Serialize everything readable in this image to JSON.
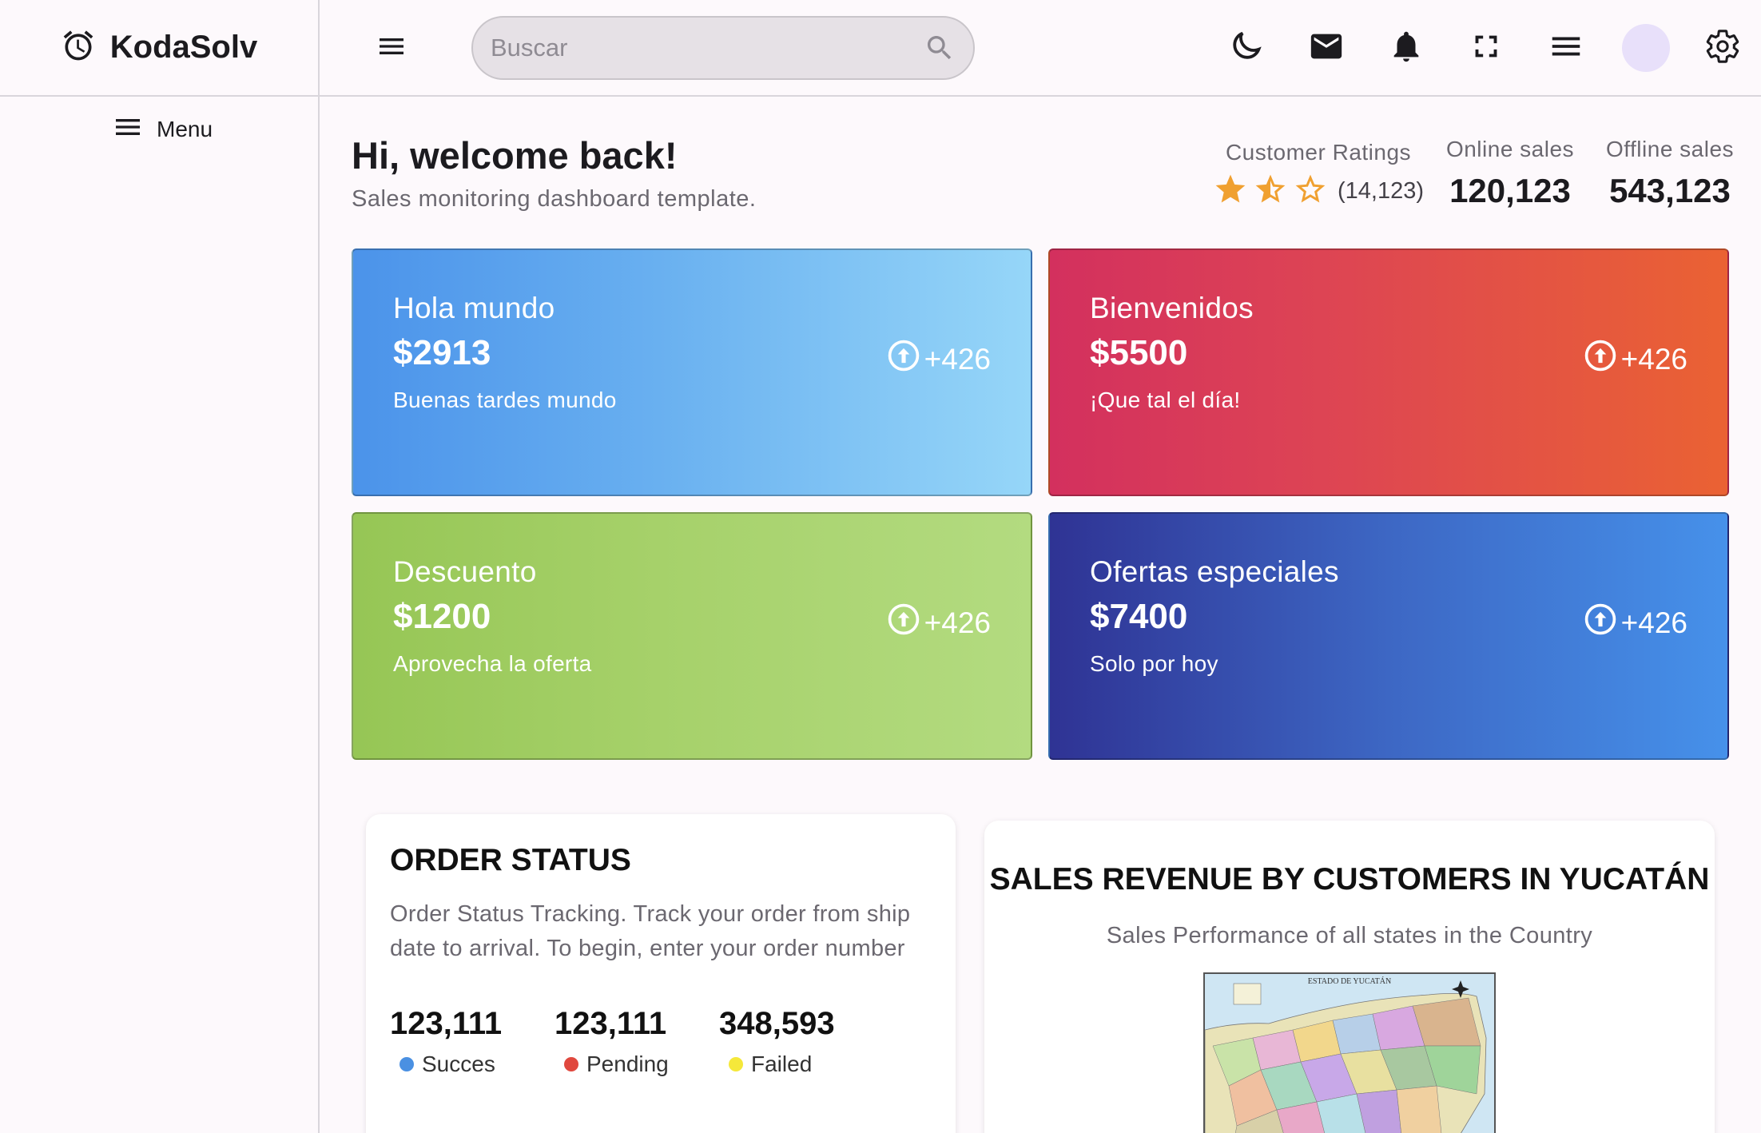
{
  "app": {
    "name": "KodaSolv"
  },
  "header": {
    "search_placeholder": "Buscar",
    "icons": [
      "menu-icon",
      "search-icon",
      "dark-mode-icon",
      "mail-icon",
      "notifications-icon",
      "fullscreen-icon",
      "list-icon",
      "avatar",
      "settings-icon"
    ]
  },
  "sidebar": {
    "menu_label": "Menu"
  },
  "welcome": {
    "title": "Hi, welcome back!",
    "subtitle": "Sales monitoring dashboard template."
  },
  "stats": {
    "ratings_label": "Customer Ratings",
    "ratings_stars": 1.5,
    "ratings_max": 3,
    "ratings_count": "(14,123)",
    "online_label": "Online sales",
    "online_value": "120,123",
    "offline_label": "Offline sales",
    "offline_value": "543,123"
  },
  "cards": [
    {
      "title": "Hola mundo",
      "amount": "$2913",
      "subtitle": "Buenas tardes mundo",
      "delta": "+426"
    },
    {
      "title": "Bienvenidos",
      "amount": "$5500",
      "subtitle": "¡Que tal el día!",
      "delta": "+426"
    },
    {
      "title": "Descuento",
      "amount": "$1200",
      "subtitle": "Aprovecha la oferta",
      "delta": "+426"
    },
    {
      "title": "Ofertas especiales",
      "amount": "$7400",
      "subtitle": "Solo por hoy",
      "delta": "+426"
    }
  ],
  "order_status": {
    "title": "ORDER STATUS",
    "description": "Order Status Tracking. Track your order from ship date to arrival. To begin, enter your order number",
    "metrics": [
      {
        "value": "123,111",
        "label": "Succes",
        "color": "#4a90e2"
      },
      {
        "value": "123,111",
        "label": "Pending",
        "color": "#e0483e"
      },
      {
        "value": "348,593",
        "label": "Failed",
        "color": "#f5e83a"
      }
    ]
  },
  "revenue": {
    "title": "SALES REVENUE BY CUSTOMERS IN YUCATÁN",
    "subtitle": "Sales Performance of all states in the Country",
    "map_title": "ESTADO DE YUCATÁN"
  },
  "colors": {
    "accent": "#6750a4",
    "star": "#f0a030",
    "avatar": "#e8e0fa"
  }
}
